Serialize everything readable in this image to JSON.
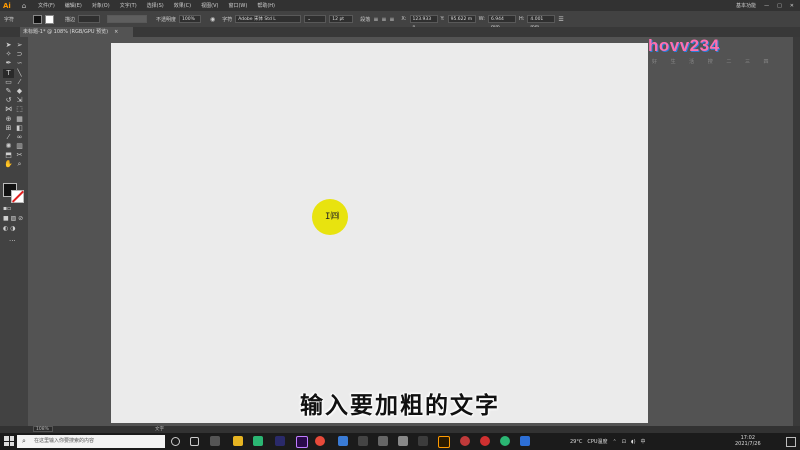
{
  "menubar": {
    "app_logo": "Ai",
    "items": [
      "文件(F)",
      "编辑(E)",
      "对象(O)",
      "文字(T)",
      "选择(S)",
      "效果(C)",
      "视图(V)",
      "窗口(W)",
      "帮助(H)"
    ],
    "workspace": "基本功能"
  },
  "control": {
    "tool_label": "字符",
    "stroke_label": "描边",
    "opacity_label": "不透明度",
    "opacity_value": "100%",
    "char_label": "字符",
    "font_name": "Adobe 宋体 Std L",
    "font_size": "12 pt",
    "para_label": "段落",
    "x_value": "123.933 n",
    "y_value": "95.622 m",
    "w_value": "6.944 mm",
    "h_value": "4.001 mm"
  },
  "tab": {
    "doc_title": "未标题-1* @ 108% (RGB/GPU 预览)",
    "close": "×"
  },
  "canvas": {
    "cursor_glyph": "I㈣",
    "watermark_text": "hovv234",
    "watermark_sub": "好 生 活 搜 二 三 四"
  },
  "subtitle": "输入要加粗的文字",
  "status": {
    "zoom": "108%",
    "tool_name": "文字"
  },
  "taskbar": {
    "search_placeholder": "在这里输入你要搜索的内容",
    "weather": "29°C",
    "cpu": "CPU温度",
    "lang": "中",
    "time": "17:02",
    "date": "2021/7/26"
  },
  "colors": {
    "accent": "#ff9a00",
    "cursor_highlight": "#e8e30f",
    "artboard": "#ebebeb"
  }
}
